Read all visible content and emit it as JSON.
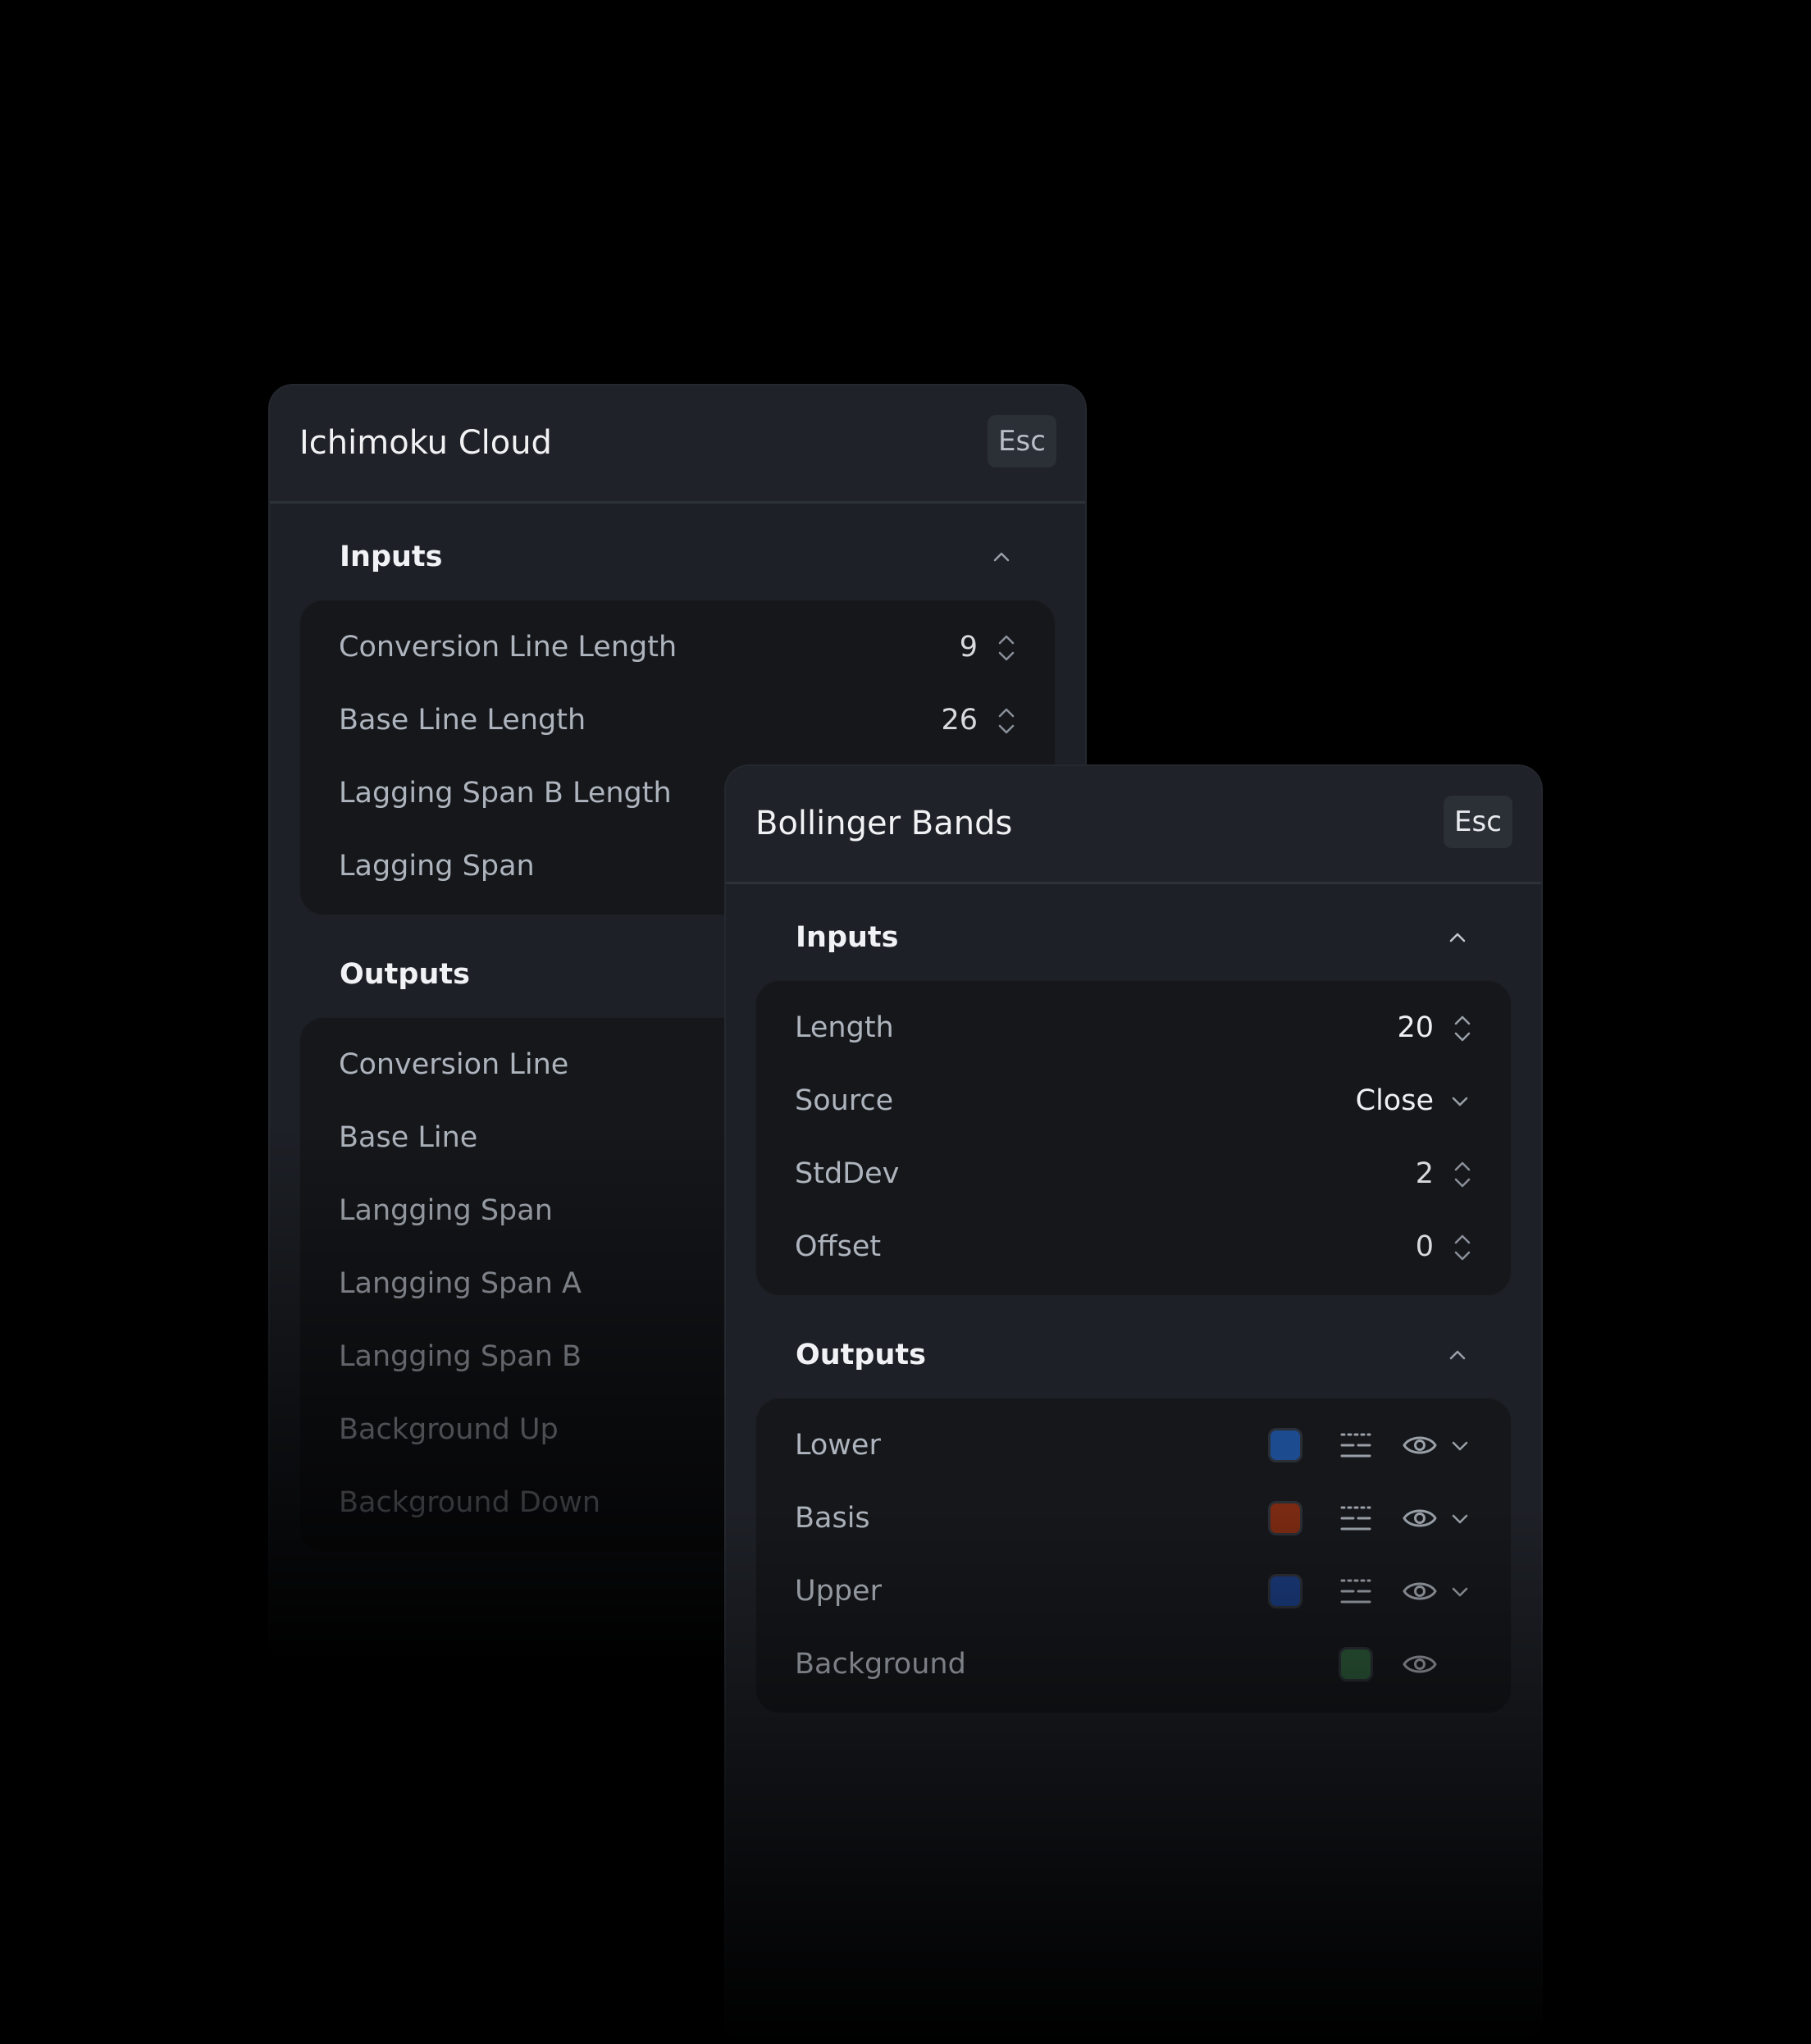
{
  "ichimoku": {
    "title": "Ichimoku Cloud",
    "esc_label": "Esc",
    "inputs_title": "Inputs",
    "inputs": [
      {
        "label": "Conversion Line Length",
        "value": "9"
      },
      {
        "label": "Base Line Length",
        "value": "26"
      },
      {
        "label": "Lagging Span B Length",
        "value": ""
      },
      {
        "label": "Lagging Span",
        "value": ""
      }
    ],
    "outputs_title": "Outputs",
    "outputs": [
      {
        "label": "Conversion Line"
      },
      {
        "label": "Base Line"
      },
      {
        "label": "Langging Span"
      },
      {
        "label": "Langging Span A"
      },
      {
        "label": "Langging Span B"
      },
      {
        "label": "Background Up"
      },
      {
        "label": "Background Down"
      }
    ]
  },
  "bollinger": {
    "title": "Bollinger Bands",
    "esc_label": "Esc",
    "inputs_title": "Inputs",
    "inputs": {
      "length": {
        "label": "Length",
        "value": "20"
      },
      "source": {
        "label": "Source",
        "value": "Close"
      },
      "stddev": {
        "label": "StdDev",
        "value": "2"
      },
      "offset": {
        "label": "Offset",
        "value": "0"
      }
    },
    "outputs_title": "Outputs",
    "outputs": [
      {
        "label": "Lower",
        "color": "#1d4b8f"
      },
      {
        "label": "Basis",
        "color": "#7a2a12"
      },
      {
        "label": "Upper",
        "color": "#1a3a7a"
      },
      {
        "label": "Background",
        "color": "#2d5a3a"
      }
    ]
  },
  "icons": {
    "stepper": "stepper-icon",
    "chevron_up": "chevron-up-icon",
    "chevron_down": "chevron-down-icon",
    "line_style": "line-style-icon",
    "eye": "eye-icon"
  },
  "colors": {
    "background": "#000000",
    "panel": "#1d2026",
    "card": "#15171b"
  }
}
